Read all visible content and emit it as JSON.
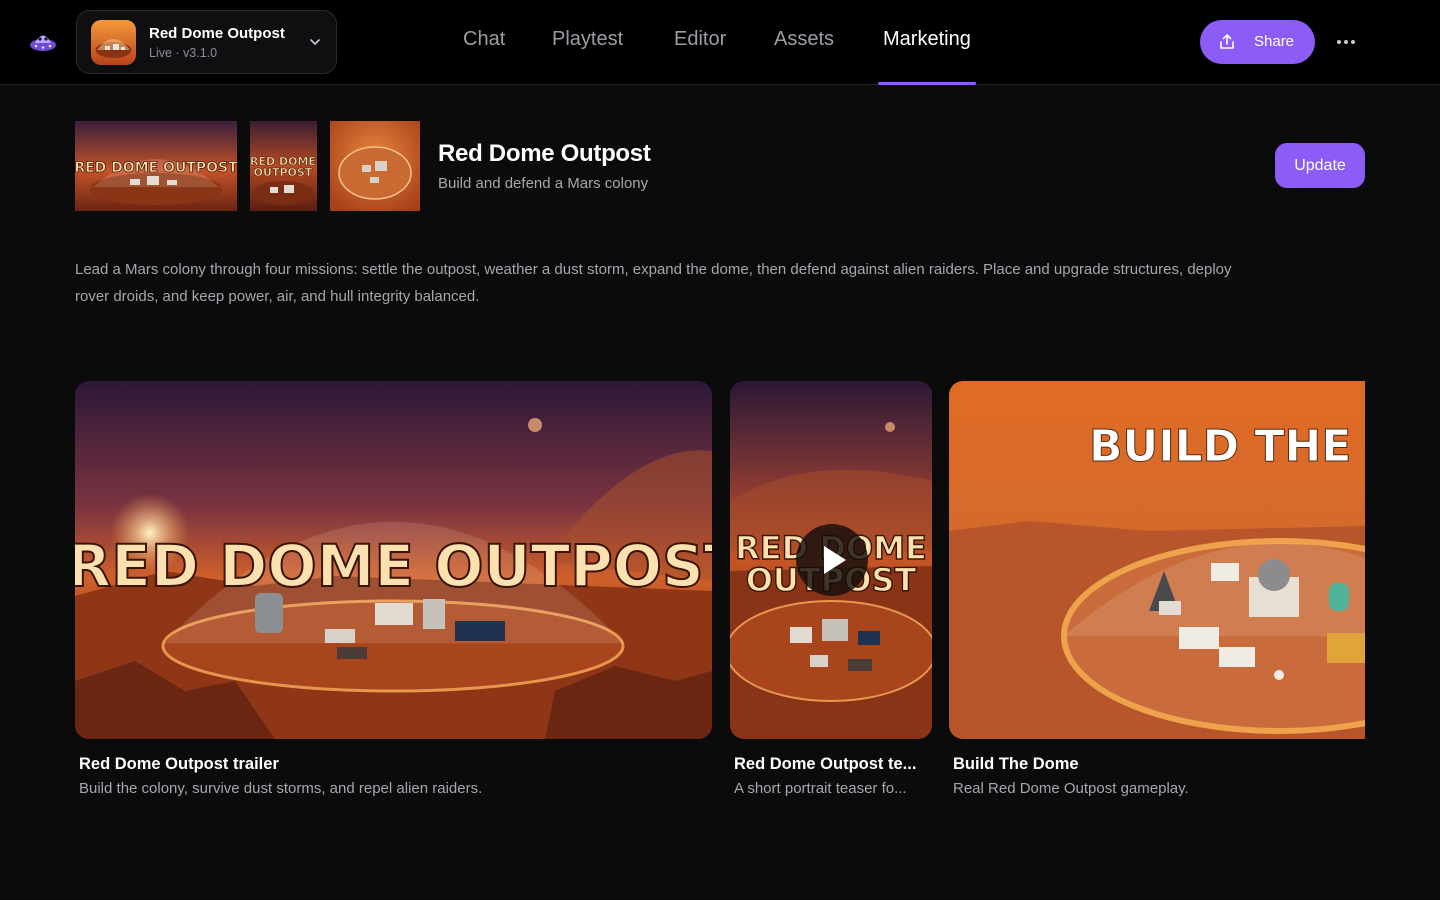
{
  "project": {
    "name": "Red Dome Outpost",
    "status": "Live · v3.1.0"
  },
  "nav": {
    "tabs": [
      {
        "label": "Chat"
      },
      {
        "label": "Playtest"
      },
      {
        "label": "Editor"
      },
      {
        "label": "Assets"
      },
      {
        "label": "Marketing"
      }
    ],
    "active_tab": "Marketing"
  },
  "toolbar": {
    "share_label": "Share",
    "more_icon": "more-horizontal-icon"
  },
  "header": {
    "thumbnail_texts": [
      "RED DOME OUTPOST",
      "RED DOME",
      "OUTPOST"
    ],
    "title": "Red Dome Outpost",
    "subtitle": "Build and defend a Mars colony",
    "update_label": "Update"
  },
  "description": "Lead a Mars colony through four missions: settle the outpost, weather a dust storm, expand the dome, then defend against alien raiders. Place and upgrade structures, deploy rover droids, and keep power, air, and hull integrity balanced.",
  "media": [
    {
      "overlay_text": "RED DOME OUTPOST",
      "title": "Red Dome Outpost trailer",
      "description": "Build the colony, survive dust storms, and repel alien raiders."
    },
    {
      "overlay_text_1": "RED DOME",
      "overlay_text_2": "OUTPOST",
      "title": "Red Dome Outpost te...",
      "description": "A short portrait teaser fo..."
    },
    {
      "overlay_text": "BUILD THE D",
      "title": "Build The Dome",
      "description": "Real Red Dome Outpost gameplay."
    }
  ],
  "colors": {
    "accent": "#8b5cf6",
    "background": "#0b0b0c",
    "topbar": "#000000",
    "muted_text": "#a6a6ae"
  }
}
